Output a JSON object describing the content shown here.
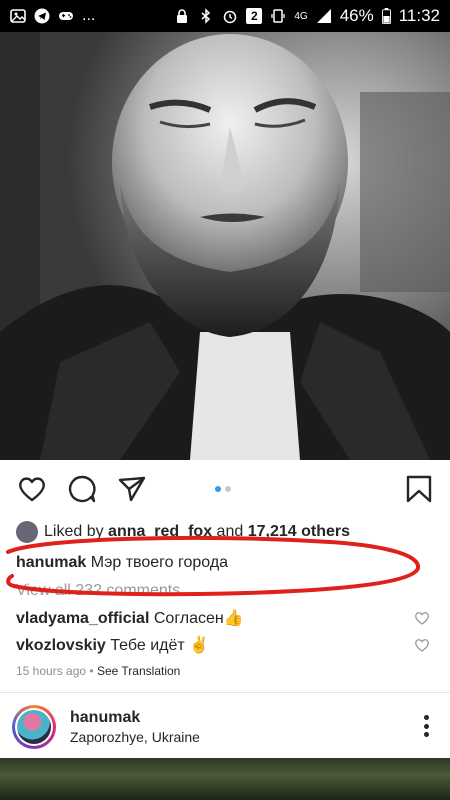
{
  "status_bar": {
    "left_icons": [
      "image-icon",
      "telegram-icon",
      "gamepad-icon"
    ],
    "ellipsis": "...",
    "notification_count": "2",
    "network": "4G",
    "battery": "46%",
    "time": "11:32"
  },
  "post": {
    "likes": {
      "prefix": "Liked by",
      "user": "anna_red_fox",
      "middle": "and",
      "others": "17,214 others"
    },
    "caption": {
      "user": "hanumak",
      "text": "Мэр твоего города"
    },
    "view_all": "View all 232 comments",
    "comments": [
      {
        "user": "vladyama_official",
        "text": "Согласен👍"
      },
      {
        "user": "vkozlovskiy",
        "text": "Тебе идёт ✌"
      }
    ],
    "time_ago": "15 hours ago",
    "separator": "•",
    "see_translation": "See Translation",
    "carousel": {
      "count": 2,
      "active": 0
    }
  },
  "profile": {
    "name": "hanumak",
    "location": "Zaporozhye, Ukraine"
  },
  "colors": {
    "accent": "#3897f0",
    "annotation": "#e0201b"
  }
}
